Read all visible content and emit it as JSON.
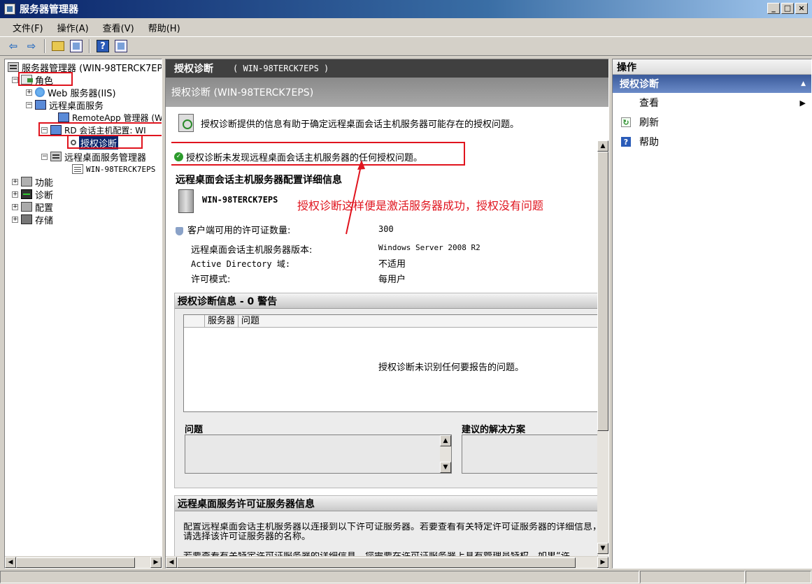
{
  "window": {
    "title": "服务器管理器"
  },
  "menu": [
    "文件(F)",
    "操作(A)",
    "查看(V)",
    "帮助(H)"
  ],
  "tree": {
    "root": "服务器管理器 (WIN-98TERCK7EP",
    "roles": "角色",
    "web": "Web 服务器(IIS)",
    "rds": "远程桌面服务",
    "remoteapp": "RemoteApp 管理器 (W",
    "rdsh": "RD 会话主机配置: WI",
    "diag": "授权诊断",
    "rdsmgr": "远程桌面服务管理器",
    "rdsmgr_child": "WIN-98TERCK7EPS",
    "features": "功能",
    "diagnostics": "诊断",
    "config": "配置",
    "storage": "存储"
  },
  "center": {
    "header_title": "授权诊断",
    "header_server": "( WIN-98TERCK7EPS )",
    "sub_header": "授权诊断 (WIN-98TERCK7EPS)",
    "info_text": "授权诊断提供的信息有助于确定远程桌面会话主机服务器可能存在的授权问题。",
    "ok_message": "授权诊断未发现远程桌面会话主机服务器的任何授权问题。",
    "details_title": "远程桌面会话主机服务器配置详细信息",
    "server_name": "WIN-98TERCK7EPS",
    "annotation": "授权诊断这样便是激活服务器成功，授权没有问题",
    "props": [
      {
        "label": "客户端可用的许可证数量:",
        "value": "300"
      },
      {
        "label": "远程桌面会话主机服务器版本:",
        "value": "Windows Server 2008 R2"
      },
      {
        "label": "Active Directory 域:",
        "value": "不适用"
      },
      {
        "label": "许可模式:",
        "value": "每用户"
      }
    ],
    "diag_panel_title": "授权诊断信息 - 0 警告",
    "grid_cols": [
      "服务器",
      "问题"
    ],
    "grid_empty": "授权诊断未识别任何要报告的问题。",
    "problem_label": "问题",
    "solution_label": "建议的解决方案",
    "license_panel_title": "远程桌面服务许可证服务器信息",
    "license_para1": "配置远程桌面会话主机服务器以连接到以下许可证服务器。若要查看有关特定许可证服务器的详细信息，请选择该许可证服务器的名称。",
    "license_para2": "若要查看有关特定许可证服务器的详细信息，您需要在许可证服务器上具有管理员特权。如果“许"
  },
  "actions": {
    "header": "操作",
    "section": "授权诊断",
    "items": [
      "查看",
      "刷新",
      "帮助"
    ]
  }
}
